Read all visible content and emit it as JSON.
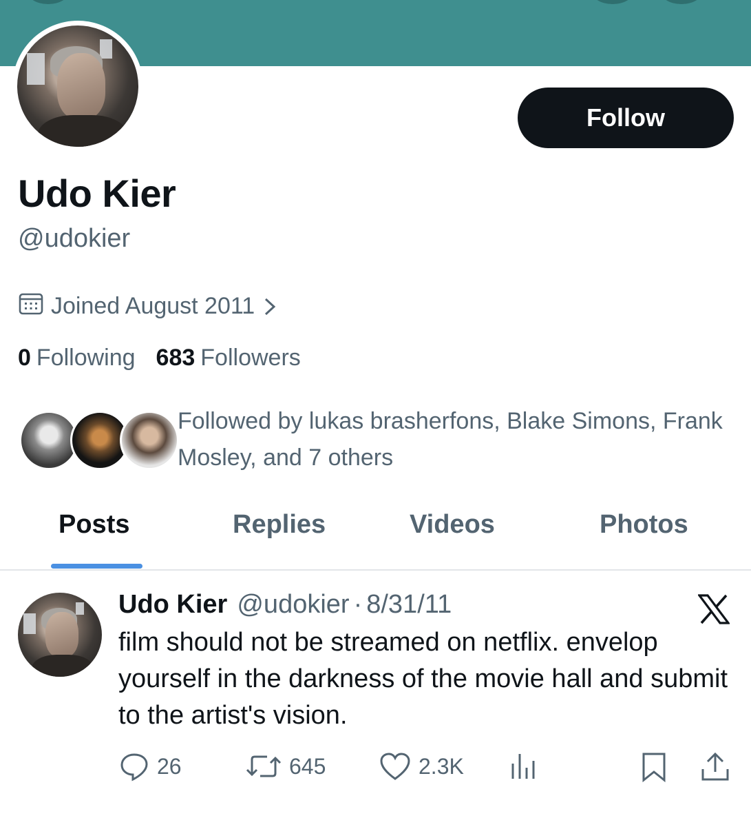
{
  "profile": {
    "display_name": "Udo Kier",
    "handle": "@udokier",
    "joined": "Joined August 2011",
    "follow_label": "Follow",
    "following_count": "0",
    "following_label": "Following",
    "followers_count": "683",
    "followers_label": "Followers",
    "followed_by_text": "Followed by lukas brasherfons, Blake Simons, Frank Mosley, and 7 others"
  },
  "tabs": [
    {
      "label": "Posts",
      "active": true
    },
    {
      "label": "Replies",
      "active": false
    },
    {
      "label": "Videos",
      "active": false
    },
    {
      "label": "Photos",
      "active": false
    }
  ],
  "post": {
    "name": "Udo Kier",
    "handle": "@udokier",
    "separator": "·",
    "date": "8/31/11",
    "text": "film should not be streamed on netflix.  envelop yourself in the darkness of the movie hall and submit to the artist's vision.",
    "replies": "26",
    "reposts": "645",
    "likes": "2.3K"
  },
  "icons": {
    "calendar": "calendar-icon",
    "chevron": "chevron-right-icon",
    "reply": "reply-icon",
    "repost": "repost-icon",
    "like": "heart-icon",
    "views": "views-icon",
    "bookmark": "bookmark-icon",
    "share": "share-icon",
    "brand": "x-logo-icon"
  },
  "colors": {
    "banner": "#3f8f8f",
    "button": "#0f1419",
    "secondary_text": "#536471",
    "tab_indicator": "#4a90e2"
  }
}
